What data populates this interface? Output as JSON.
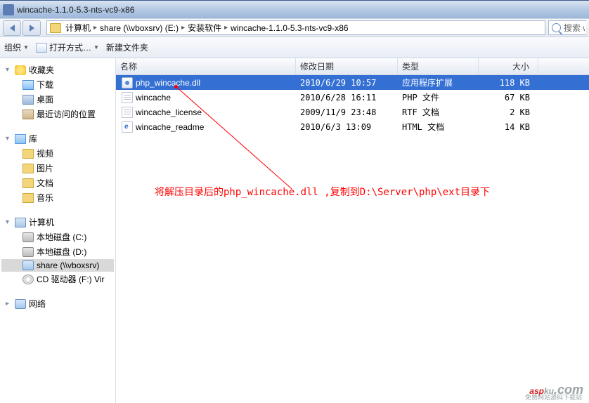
{
  "window": {
    "title": "wincache-1.1.0-5.3-nts-vc9-x86"
  },
  "breadcrumb": {
    "items": [
      "计算机",
      "share (\\\\vboxsrv) (E:)",
      "安装软件",
      "wincache-1.1.0-5.3-nts-vc9-x86"
    ]
  },
  "search": {
    "placeholder": "搜索 win"
  },
  "toolbar": {
    "organize": "组织",
    "open_with": "打开方式…",
    "new_folder": "新建文件夹"
  },
  "sidebar": {
    "favorites": {
      "label": "收藏夹",
      "items": [
        "下载",
        "桌面",
        "最近访问的位置"
      ]
    },
    "libraries": {
      "label": "库",
      "items": [
        "视频",
        "图片",
        "文档",
        "音乐"
      ]
    },
    "computer": {
      "label": "计算机",
      "items": [
        "本地磁盘 (C:)",
        "本地磁盘 (D:)",
        "share (\\\\vboxsrv)",
        "CD 驱动器 (F:) Vir"
      ]
    },
    "network": {
      "label": "网络"
    }
  },
  "columns": {
    "name": "名称",
    "date": "修改日期",
    "type": "类型",
    "size": "大小"
  },
  "files": [
    {
      "name": "php_wincache.dll",
      "date": "2010/6/29 10:57",
      "type": "应用程序扩展",
      "size": "118 KB",
      "icon": "dll",
      "selected": true
    },
    {
      "name": "wincache",
      "date": "2010/6/28 16:11",
      "type": "PHP 文件",
      "size": "67 KB",
      "icon": "txt",
      "selected": false
    },
    {
      "name": "wincache_license",
      "date": "2009/11/9 23:48",
      "type": "RTF 文档",
      "size": "2 KB",
      "icon": "txt",
      "selected": false
    },
    {
      "name": "wincache_readme",
      "date": "2010/6/3 13:09",
      "type": "HTML 文档",
      "size": "14 KB",
      "icon": "html",
      "selected": false
    }
  ],
  "annotation": {
    "text": "将解压目录后的php_wincache.dll ,复制到D:\\Server\\php\\ext目录下"
  },
  "watermark": {
    "main_red": "asp",
    "main_gray1": "ku",
    "main_gray2": ".com",
    "sub": "免费网站源码下载站"
  }
}
